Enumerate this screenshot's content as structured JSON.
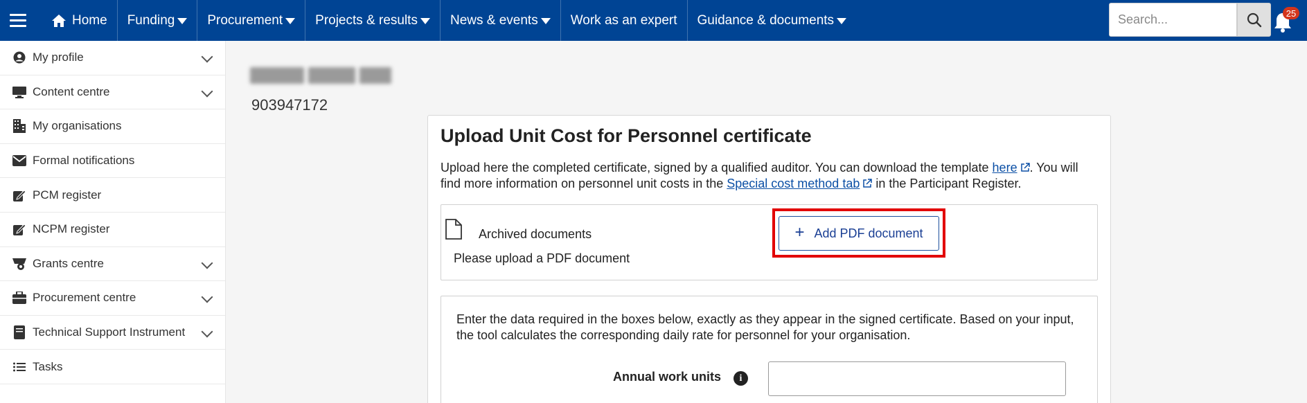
{
  "nav": {
    "home": "Home",
    "items": [
      "Funding",
      "Procurement",
      "Projects & results",
      "News & events",
      "Work as an expert",
      "Guidance & documents"
    ],
    "search_placeholder": "Search...",
    "notifications_count": "25"
  },
  "sidebar": {
    "items": [
      {
        "label": "My profile",
        "icon": "user-circle-icon",
        "expandable": true
      },
      {
        "label": "Content centre",
        "icon": "monitor-icon",
        "expandable": true
      },
      {
        "label": "My organisations",
        "icon": "building-icon",
        "expandable": false
      },
      {
        "label": "Formal notifications",
        "icon": "envelope-icon",
        "expandable": false
      },
      {
        "label": "PCM register",
        "icon": "edit-check-icon",
        "expandable": false
      },
      {
        "label": "NCPM register",
        "icon": "edit-check-icon",
        "expandable": false
      },
      {
        "label": "Grants centre",
        "icon": "grants-icon",
        "expandable": true
      },
      {
        "label": "Procurement centre",
        "icon": "briefcase-icon",
        "expandable": true
      },
      {
        "label": "Technical Support Instrument",
        "icon": "book-icon",
        "expandable": true
      },
      {
        "label": "Tasks",
        "icon": "list-icon",
        "expandable": false
      }
    ]
  },
  "main": {
    "pic": "903947172",
    "card": {
      "title": "Upload Unit Cost for Personnel certificate",
      "desc_part1": "Upload here the completed certificate, signed by a qualified auditor. You can download the template ",
      "desc_link1": "here",
      "desc_part2": ". You will find more information on personnel unit costs in the ",
      "desc_link2": "Special cost method tab",
      "desc_part3": " in the Participant Register.",
      "archived_label": "Archived documents",
      "upload_hint": "Please upload a PDF document",
      "add_pdf_label": "Add PDF document",
      "data_desc": "Enter the data required in the boxes below, exactly as they appear in the signed certificate. Based on your input, the tool calculates the corresponding daily rate for personnel for your organisation.",
      "annual_label": "Annual work units",
      "annual_value": ""
    }
  },
  "colors": {
    "nav_bg": "#004494",
    "highlight": "#e20000",
    "link": "#0b4fa5",
    "badge": "#d4351c"
  }
}
